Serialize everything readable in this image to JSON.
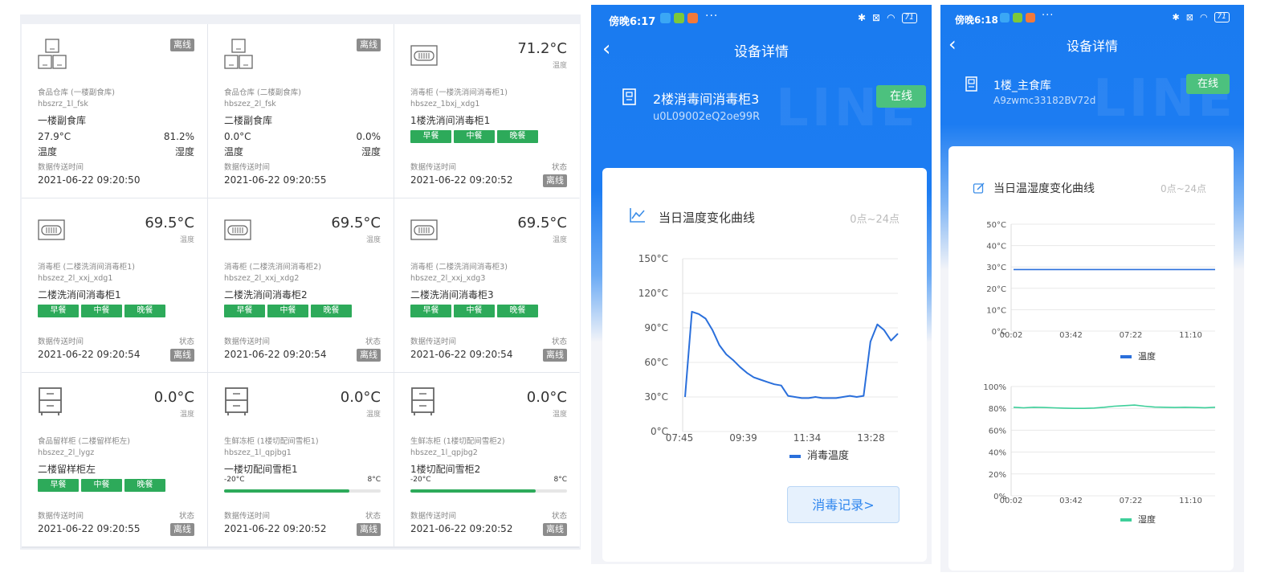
{
  "dashboard": {
    "labels": {
      "temp": "温度",
      "humidity": "湿度",
      "transmit_time": "数据传送时间",
      "status": "状态",
      "offline": "离线",
      "breakfast": "早餐",
      "lunch": "中餐",
      "dinner": "晚餐"
    },
    "cards": [
      {
        "kind": "warehouse",
        "type": "食品仓库 (一楼副食库)",
        "code": "hbszrz_1l_fsk",
        "name": "一楼副食库",
        "temp": "27.9°C",
        "humidity": "81.2%",
        "time": "2021-06-22 09:20:50"
      },
      {
        "kind": "warehouse",
        "type": "食品仓库 (二楼副食库)",
        "code": "hbszez_2l_fsk",
        "name": "二楼副食库",
        "temp": "0.0°C",
        "humidity": "0.0%",
        "time": "2021-06-22 09:20:55"
      },
      {
        "kind": "disinfect",
        "type": "消毒柜 (一楼洗消间消毒柜1)",
        "code": "hbszez_1bxj_xdg1",
        "name": "1楼洗消间消毒柜1",
        "temp": "71.2°C",
        "time": "2021-06-22 09:20:52"
      },
      {
        "kind": "disinfect",
        "type": "消毒柜 (二楼洗消间消毒柜1)",
        "code": "hbszez_2l_xxj_xdg1",
        "name": "二楼洗消间消毒柜1",
        "temp": "69.5°C",
        "time": "2021-06-22 09:20:54"
      },
      {
        "kind": "disinfect",
        "type": "消毒柜 (二楼洗消间消毒柜2)",
        "code": "hbszez_2l_xxj_xdg2",
        "name": "二楼洗消间消毒柜2",
        "temp": "69.5°C",
        "time": "2021-06-22 09:20:54"
      },
      {
        "kind": "disinfect",
        "type": "消毒柜 (二楼洗消间消毒柜3)",
        "code": "hbszez_2l_xxj_xdg3",
        "name": "二楼洗消间消毒柜3",
        "temp": "69.5°C",
        "time": "2021-06-22 09:20:54"
      },
      {
        "kind": "sample",
        "type": "食品留样柜 (二楼留样柜左)",
        "code": "hbszez_2l_lygz",
        "name": "二楼留样柜左",
        "temp": "0.0°C",
        "time": "2021-06-22 09:20:55"
      },
      {
        "kind": "freezer",
        "type": "生鲜冻柜 (1楼切配间雪柜1)",
        "code": "hbszez_1l_qpjbg1",
        "name": "一楼切配间雪柜1",
        "temp": "0.0°C",
        "range_min": "-20°C",
        "range_max": "8°C",
        "range_fill": 0.8,
        "time": "2021-06-22 09:20:52"
      },
      {
        "kind": "freezer",
        "type": "生鲜冻柜 (1楼切配间雪柜2)",
        "code": "hbszez_1l_qpjbg2",
        "name": "1楼切配间雪柜2",
        "temp": "0.0°C",
        "range_min": "-20°C",
        "range_max": "8°C",
        "range_fill": 0.8,
        "time": "2021-06-22 09:20:52"
      }
    ]
  },
  "phone1": {
    "status_time": "傍晚6:17",
    "status_dots": "···",
    "battery": "71",
    "nav_title": "设备详情",
    "watermark": "LINE",
    "device_name": "2楼消毒间消毒柜3",
    "device_id": "u0L09002eQ2oe99R",
    "online": "在线",
    "panel_title": "当日温度变化曲线",
    "panel_range": "0点~24点",
    "record_button": "消毒记录>",
    "colors": {
      "line": "#2a6fdb",
      "accent": "#1c7cf2",
      "online": "#4cc17e"
    }
  },
  "phone2": {
    "status_time": "傍晚6:18",
    "status_dots": "···",
    "battery": "71",
    "nav_title": "设备详情",
    "watermark": "LINE",
    "device_name": "1楼_主食库",
    "device_id": "A9zwmc33182BV72d",
    "online": "在线",
    "panel_title": "当日温湿度变化曲线",
    "panel_range": "0点~24点",
    "colors": {
      "temp_line": "#2a6fdb",
      "humid_line": "#3ecf9a"
    }
  },
  "chart_data": [
    {
      "type": "line",
      "title": "当日温度变化曲线",
      "x_ticks": [
        "07:45",
        "09:39",
        "11:34",
        "13:28"
      ],
      "y_ticks": [
        "0°C",
        "30°C",
        "60°C",
        "90°C",
        "120°C",
        "150°C"
      ],
      "ylim": [
        0,
        150
      ],
      "grid": true,
      "legend_position": "bottom",
      "series": [
        {
          "name": "消毒温度",
          "values": [
            30,
            104,
            102,
            98,
            88,
            75,
            67,
            62,
            56,
            51,
            47,
            45,
            43,
            41,
            40,
            31,
            30,
            29,
            29,
            30,
            29,
            29,
            29,
            30,
            31,
            30,
            31,
            78,
            93,
            88,
            79,
            85
          ]
        }
      ]
    },
    {
      "type": "line",
      "x_ticks": [
        "00:02",
        "03:42",
        "07:22",
        "11:10"
      ],
      "y_ticks": [
        "0°C",
        "10°C",
        "20°C",
        "30°C",
        "40°C",
        "50°C"
      ],
      "ylim": [
        0,
        50
      ],
      "grid": true,
      "legend_position": "bottom",
      "series": [
        {
          "name": "温度",
          "values": [
            28.8,
            28.8,
            28.8,
            28.8,
            28.8,
            28.8,
            28.8,
            28.8,
            28.8,
            28.8,
            28.8,
            28.8,
            28.8,
            28.8,
            28.8,
            28.8,
            28.8,
            28.8,
            28.8,
            28.8
          ]
        }
      ]
    },
    {
      "type": "line",
      "x_ticks": [
        "00:02",
        "03:42",
        "07:22",
        "11:10"
      ],
      "y_ticks": [
        "0%",
        "20%",
        "40%",
        "60%",
        "80%",
        "100%"
      ],
      "ylim": [
        0,
        100
      ],
      "grid": true,
      "legend_position": "bottom",
      "series": [
        {
          "name": "湿度",
          "values": [
            81,
            80.5,
            81,
            80.8,
            80.5,
            80.2,
            80,
            80,
            80.3,
            81,
            82,
            82.5,
            83,
            82,
            81.2,
            81,
            80.8,
            81,
            80.8,
            80.6,
            81
          ]
        }
      ]
    }
  ]
}
